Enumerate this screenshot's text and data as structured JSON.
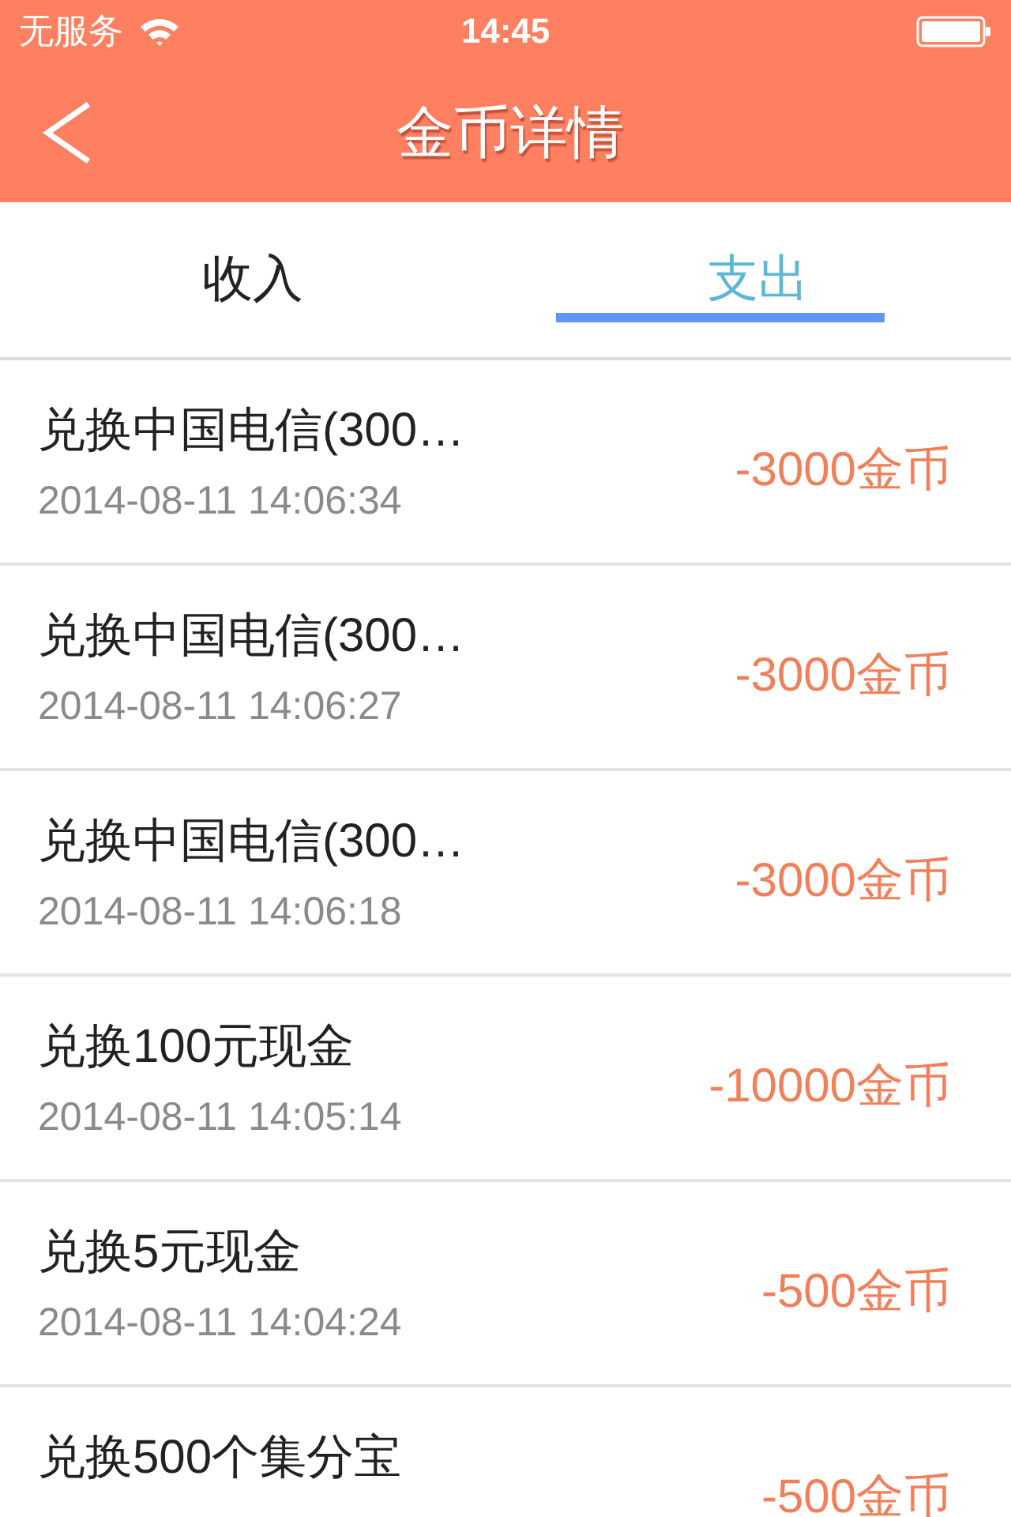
{
  "status_bar": {
    "carrier": "无服务",
    "time": "14:45"
  },
  "nav": {
    "title": "金币详情"
  },
  "tabs": [
    {
      "label": "收入",
      "selected": false
    },
    {
      "label": "支出",
      "selected": true
    }
  ],
  "records": [
    {
      "title": "兑换中国电信(300…",
      "date": "2014-08-11 14:06:34",
      "amount": "-3000金币"
    },
    {
      "title": "兑换中国电信(300…",
      "date": "2014-08-11 14:06:27",
      "amount": "-3000金币"
    },
    {
      "title": "兑换中国电信(300…",
      "date": "2014-08-11 14:06:18",
      "amount": "-3000金币"
    },
    {
      "title": "兑换100元现金",
      "date": "2014-08-11 14:05:14",
      "amount": "-10000金币"
    },
    {
      "title": "兑换5元现金",
      "date": "2014-08-11 14:04:24",
      "amount": "-500金币"
    },
    {
      "title": "兑换500个集分宝",
      "amount": "-500金币"
    }
  ]
}
